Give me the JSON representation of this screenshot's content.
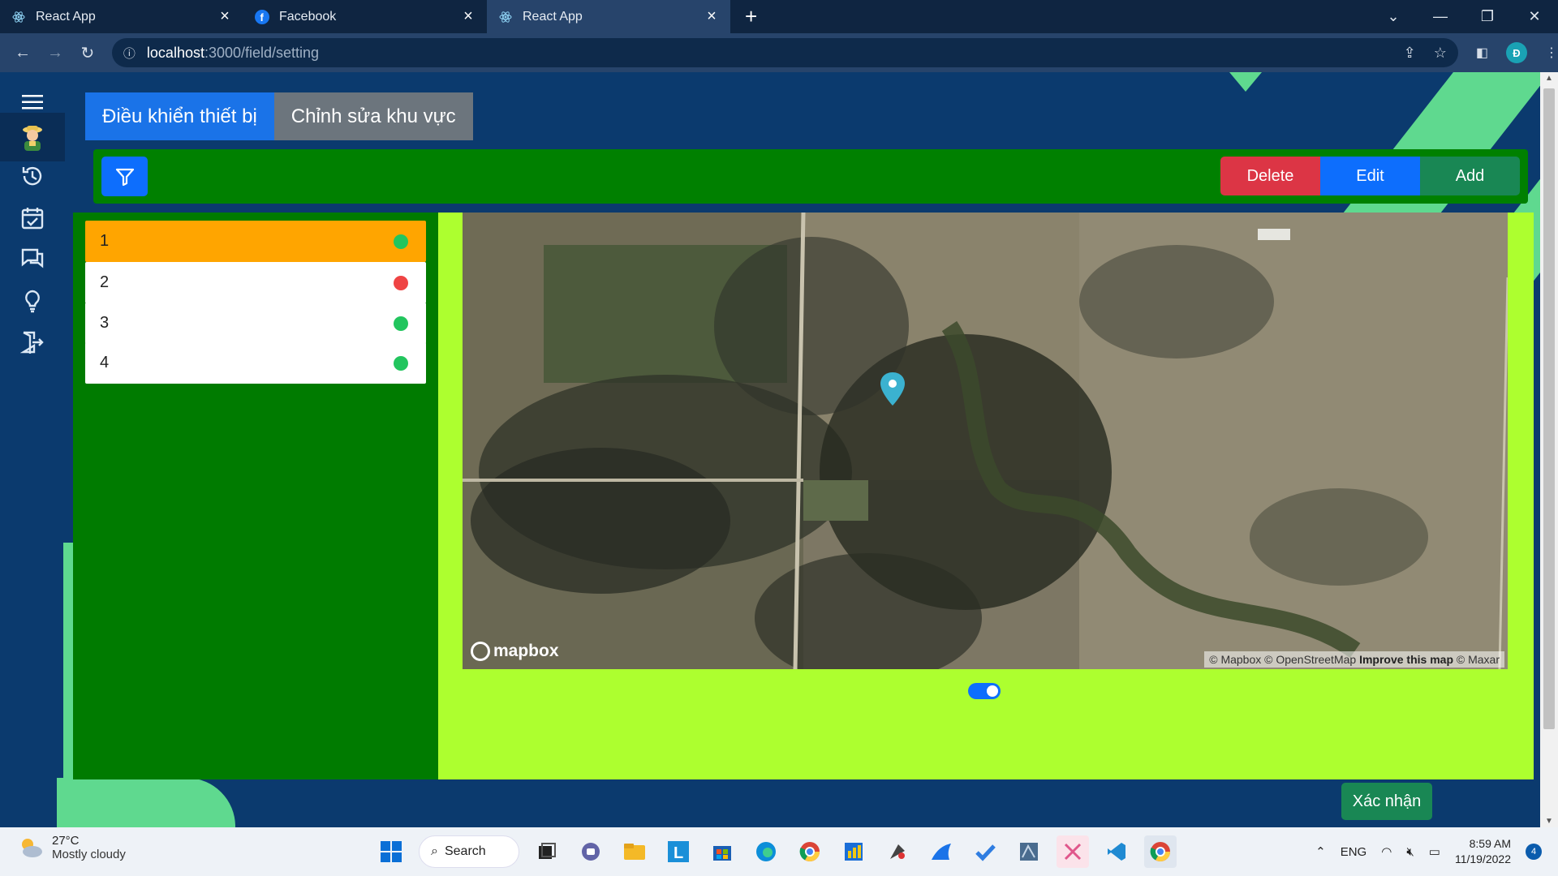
{
  "browser": {
    "tabs": [
      {
        "title": "React App",
        "icon": "react-icon"
      },
      {
        "title": "Facebook",
        "icon": "facebook-icon"
      },
      {
        "title": "React App",
        "icon": "react-icon"
      }
    ],
    "url_host": "localhost",
    "url_path": ":3000/field/setting",
    "profile_initial": "Đ"
  },
  "app": {
    "tab_control": "Điều khiển thiết bị",
    "tab_edit": "Chỉnh sửa khu vực",
    "toolbar": {
      "delete": "Delete",
      "edit": "Edit",
      "add": "Add"
    },
    "fields": [
      {
        "label": "1",
        "status_color": "#22c55e",
        "selected": true
      },
      {
        "label": "2",
        "status_color": "#ef4444",
        "selected": false
      },
      {
        "label": "3",
        "status_color": "#22c55e",
        "selected": false
      },
      {
        "label": "4",
        "status_color": "#22c55e",
        "selected": false
      }
    ],
    "map": {
      "logo": "mapbox",
      "attribution_1": "© Mapbox © OpenStreetMap ",
      "attribution_improve": "Improve this map",
      "attribution_2": " © Maxar"
    },
    "confirm": "Xác nhận"
  },
  "taskbar": {
    "temp": "27°C",
    "weather": "Mostly cloudy",
    "search": "Search",
    "lang": "ENG",
    "time": "8:59 AM",
    "date": "11/19/2022",
    "notif_count": "4"
  },
  "colors": {
    "accent_blue": "#0d6efd",
    "toolbar_green": "#008000",
    "map_panel": "#adff2f",
    "selected_row": "#ffa500"
  }
}
